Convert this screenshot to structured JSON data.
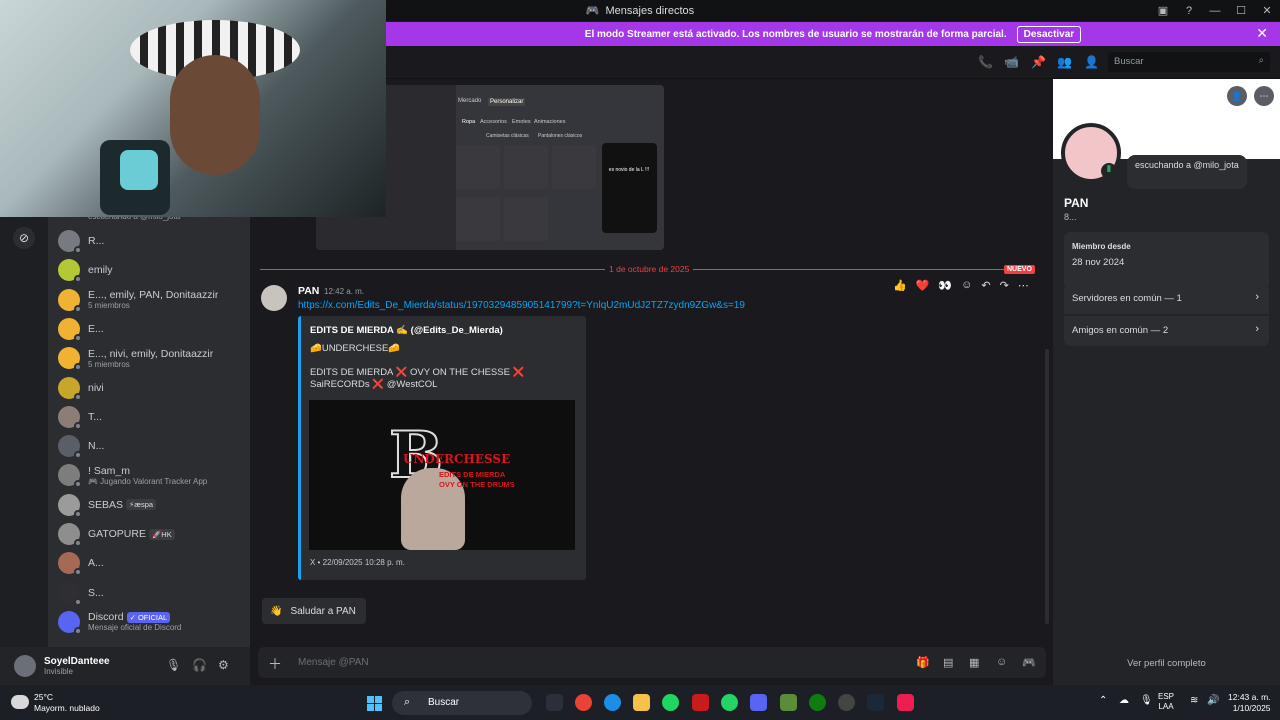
{
  "window": {
    "title": "Mensajes directos"
  },
  "banner": {
    "text": "El modo Streamer está activado. Los nombres de usuario se mostrarán de forma parcial.",
    "button": "Desactivar"
  },
  "search": {
    "placeholder": "Buscar"
  },
  "dm_list": {
    "partial_top": "escuchando a @milo_jota",
    "items": [
      {
        "name": "R...",
        "sub": "",
        "color": "#777a80"
      },
      {
        "name": "emily",
        "sub": "",
        "color": "#b4c836"
      },
      {
        "name": "E..., emily, PAN, Donitaazzir",
        "sub": "5 miembros",
        "color": "#f0b232"
      },
      {
        "name": "E...",
        "sub": "",
        "color": "#f0b232"
      },
      {
        "name": "E..., nivi, emily, Donitaazzir",
        "sub": "5 miembros",
        "color": "#f0b232"
      },
      {
        "name": "nivi",
        "sub": "",
        "color": "#c8a62a"
      },
      {
        "name": "T...",
        "sub": "",
        "color": "#8a7e76"
      },
      {
        "name": "N...",
        "sub": "",
        "color": "#5a5e68"
      },
      {
        "name": "! Sam_m",
        "sub": "🎮 Jugando Valorant Tracker App",
        "color": "#7d7d7d"
      },
      {
        "name": "SEBAS",
        "sub": "",
        "color": "#9b9b9b",
        "tag": "⚡æspa"
      },
      {
        "name": "GATOPURE",
        "sub": "",
        "color": "#8e8e8e",
        "tag": "🚀HK"
      },
      {
        "name": "A...",
        "sub": "",
        "color": "#a46a55"
      },
      {
        "name": "S...",
        "sub": "",
        "color": "#2f2f33"
      },
      {
        "name": "Discord",
        "sub": "Mensaje oficial de Discord",
        "color": "#5865f2",
        "tag": "✓ OFICIAL"
      }
    ]
  },
  "user": {
    "name": "SoyelDanteee",
    "status": "Invisible"
  },
  "chat": {
    "date_divider": "1 de octubre de 2025",
    "new_label": "NUEVO",
    "message": {
      "author": "PAN",
      "time": "12:42 a. m.",
      "link": "https://x.com/Edits_De_Mierda/status/1970329485905141799?t=YnlqU2mUdJ2TZ7zydn9ZGw&s=19",
      "embed": {
        "author": "EDITS DE MIERDA ✍️ (@Edits_De_Mierda)",
        "line1": "🧀UNDERCHESE🧀",
        "line2": "EDITS DE MIERDA ❌ OVY ON THE CHESSE ❌ SaiRECORDs ❌ @WestCOL",
        "image_title": "UNDERCHESSE",
        "image_sub": "EDITS DE MIERDA OVY ON THE DRUMS",
        "footer": "X • 22/09/2025 10:28 p. m."
      }
    },
    "reactions": [
      "👍",
      "❤️",
      "👀"
    ],
    "wave_label": "Saludar a PAN",
    "preview": {
      "tabs": [
        "Mercado",
        "Personalizar"
      ],
      "categories": [
        "Ropa",
        "Accesorios",
        "Emotes",
        "Animaciones"
      ],
      "subcats": [
        "Camisetas clásicas",
        "Pantalones clásicos"
      ],
      "shirt_text": "es novio de la L !!!"
    }
  },
  "composer": {
    "placeholder": "Mensaje @PAN"
  },
  "profile": {
    "name": "PAN",
    "subname": "8...",
    "activity": "escuchando a @milo_jota",
    "member_since_label": "Miembro desde",
    "member_since": "28 nov 2024",
    "servers": "Servidores en común — 1",
    "friends": "Amigos en común — 2",
    "view_full": "Ver perfil completo"
  },
  "taskbar": {
    "temp": "25°C",
    "weather": "Mayorm. nublado",
    "search": "Buscar",
    "lang1": "ESP",
    "lang2": "LAA",
    "time": "12:43 a. m.",
    "date": "1/10/2025"
  }
}
